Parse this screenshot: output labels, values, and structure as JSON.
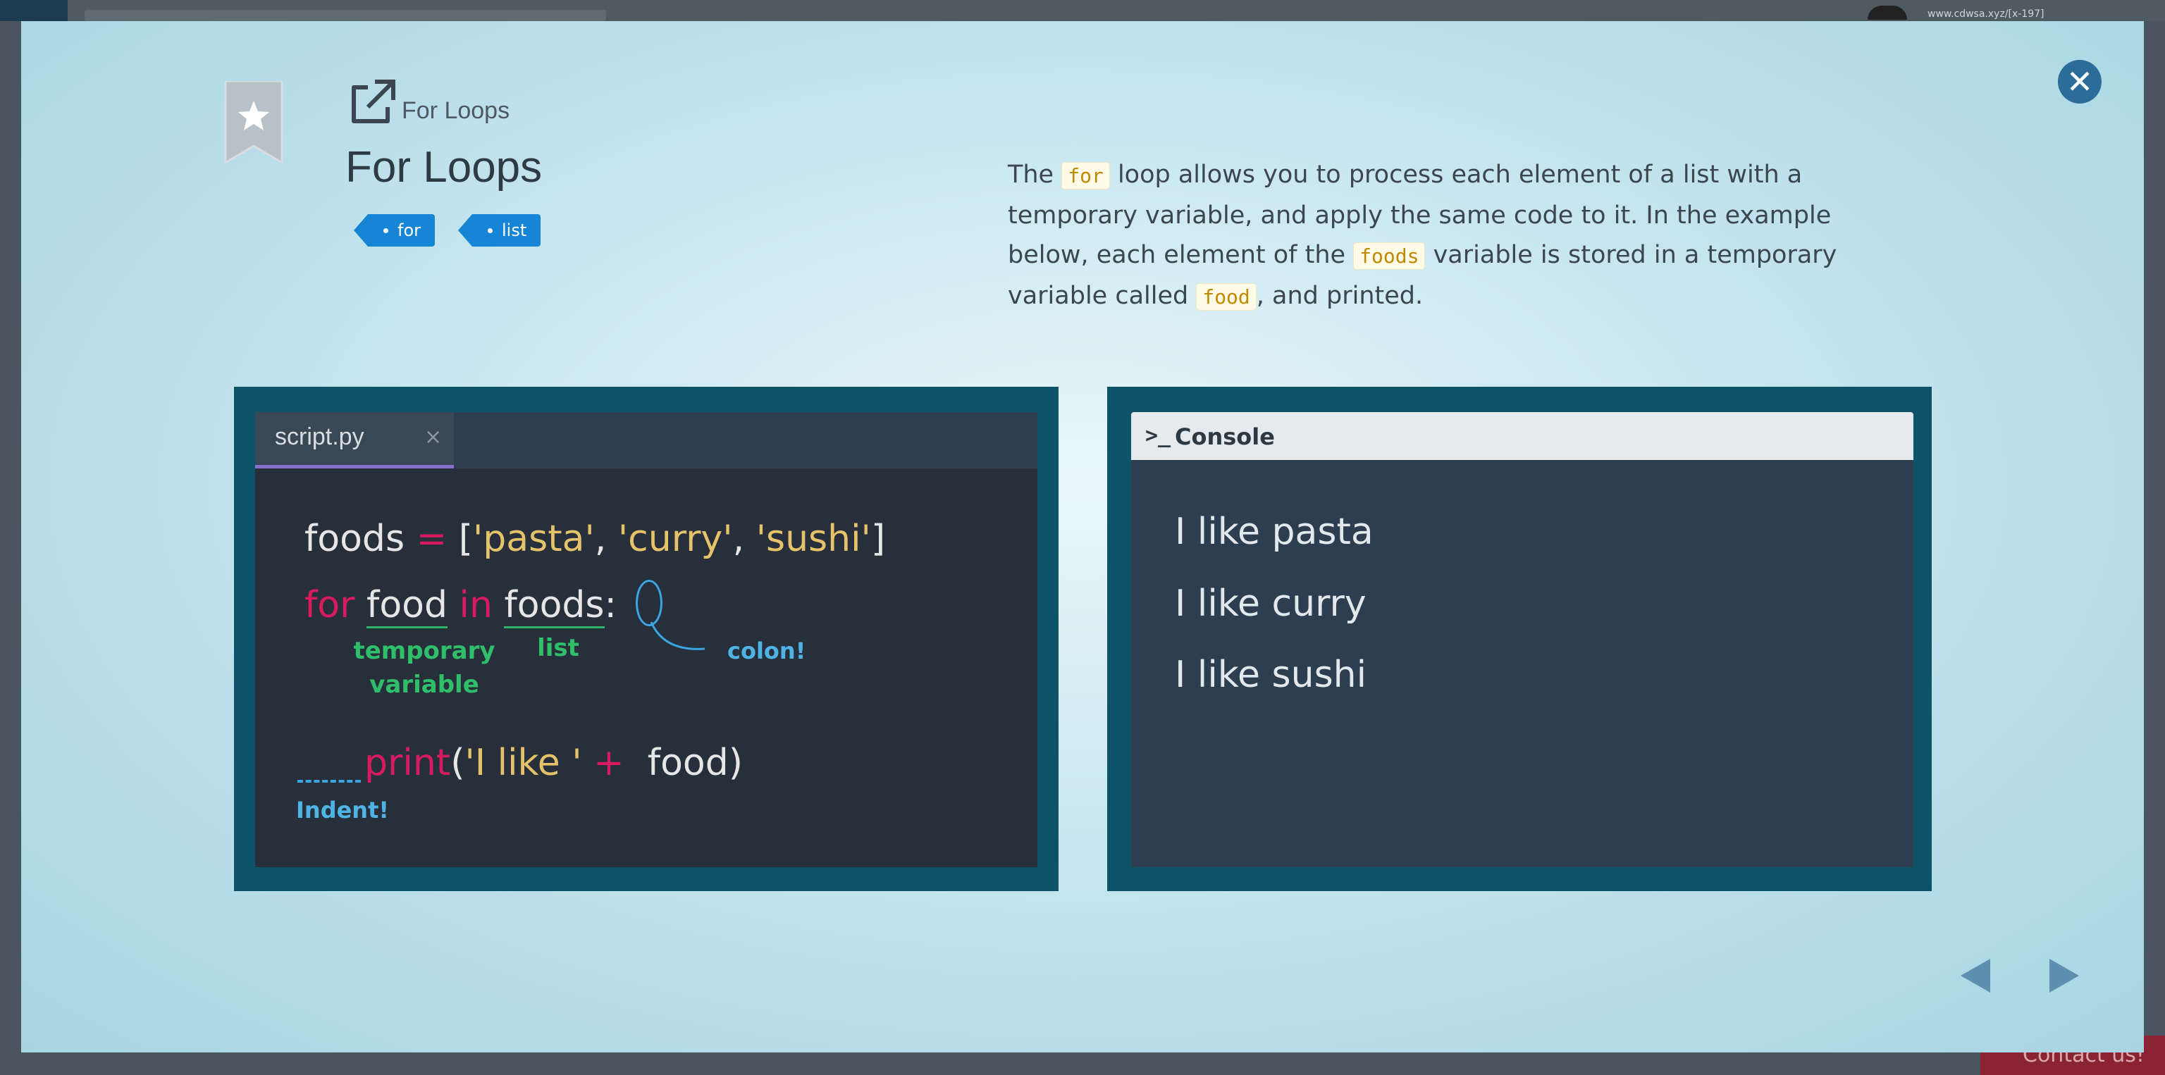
{
  "background": {
    "url_text": "www.cdwsa.xyz/[x-197]",
    "contact_label": "Contact us!"
  },
  "modal": {
    "breadcrumb": "For Loops",
    "title": "For Loops",
    "tags": [
      "for",
      "list"
    ],
    "close_icon": "close-icon",
    "description": {
      "part1": "The ",
      "code1": "for",
      "part2": " loop allows you to process each element of a list with a temporary variable, and apply the same code to it. In the example below, each element of the ",
      "code2": "foods",
      "part3": " variable is stored in a temporary variable called ",
      "code3": "food",
      "part4": ", and printed."
    },
    "editor": {
      "tab_label": "script.py",
      "tab_close": "×",
      "line1": {
        "var": "foods",
        "eq": " = ",
        "open": "[",
        "s1": "'pasta'",
        "c1": ", ",
        "s2": "'curry'",
        "c2": ", ",
        "s3": "'sushi'",
        "close": "]"
      },
      "line2": {
        "for": "for",
        "item": "food",
        "in": "in",
        "list": "foods",
        "colon": ":"
      },
      "line3": {
        "print": "print",
        "open": "(",
        "str": "'I like '",
        "plus": " + ",
        "var": " food",
        "close": ")"
      },
      "note_temp": "temporary\nvariable",
      "note_list": "list",
      "note_colon": "colon!",
      "note_indent": "Indent!"
    },
    "console": {
      "icon": ">_",
      "title": "Console",
      "lines": [
        "I like pasta",
        "I like curry",
        "I like sushi"
      ]
    }
  }
}
